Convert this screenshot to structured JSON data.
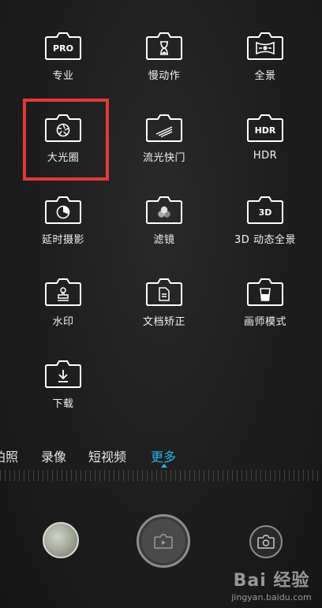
{
  "modes": [
    {
      "label": "专业",
      "icon": "pro-mode-icon",
      "glyph": "PRO"
    },
    {
      "label": "慢动作",
      "icon": "hourglass-icon",
      "glyph": ""
    },
    {
      "label": "全景",
      "icon": "panorama-icon",
      "glyph": ""
    },
    {
      "label": "大光圈",
      "icon": "aperture-icon",
      "glyph": ""
    },
    {
      "label": "流光快门",
      "icon": "light-trail-icon",
      "glyph": ""
    },
    {
      "label": "HDR",
      "icon": "hdr-icon",
      "glyph": "HDR"
    },
    {
      "label": "延时摄影",
      "icon": "time-lapse-icon",
      "glyph": ""
    },
    {
      "label": "滤镜",
      "icon": "filter-icon",
      "glyph": ""
    },
    {
      "label": "3D 动态全景",
      "icon": "3d-panorama-icon",
      "glyph": "3D"
    },
    {
      "label": "水印",
      "icon": "watermark-stamp-icon",
      "glyph": ""
    },
    {
      "label": "文档矫正",
      "icon": "document-icon",
      "glyph": ""
    },
    {
      "label": "画师模式",
      "icon": "painter-cup-icon",
      "glyph": ""
    },
    {
      "label": "下载",
      "icon": "download-icon",
      "glyph": ""
    }
  ],
  "tabs": [
    {
      "label": "拍照"
    },
    {
      "label": "录像"
    },
    {
      "label": "短视频"
    },
    {
      "label": "更多"
    }
  ],
  "active_tab": "更多",
  "colors": {
    "accent": "#26b6ea",
    "highlight_box": "#e53935",
    "background": "#1e1e1e"
  },
  "watermark": {
    "brand": "Bai 经验",
    "url": "jingyan.baidu.com"
  }
}
